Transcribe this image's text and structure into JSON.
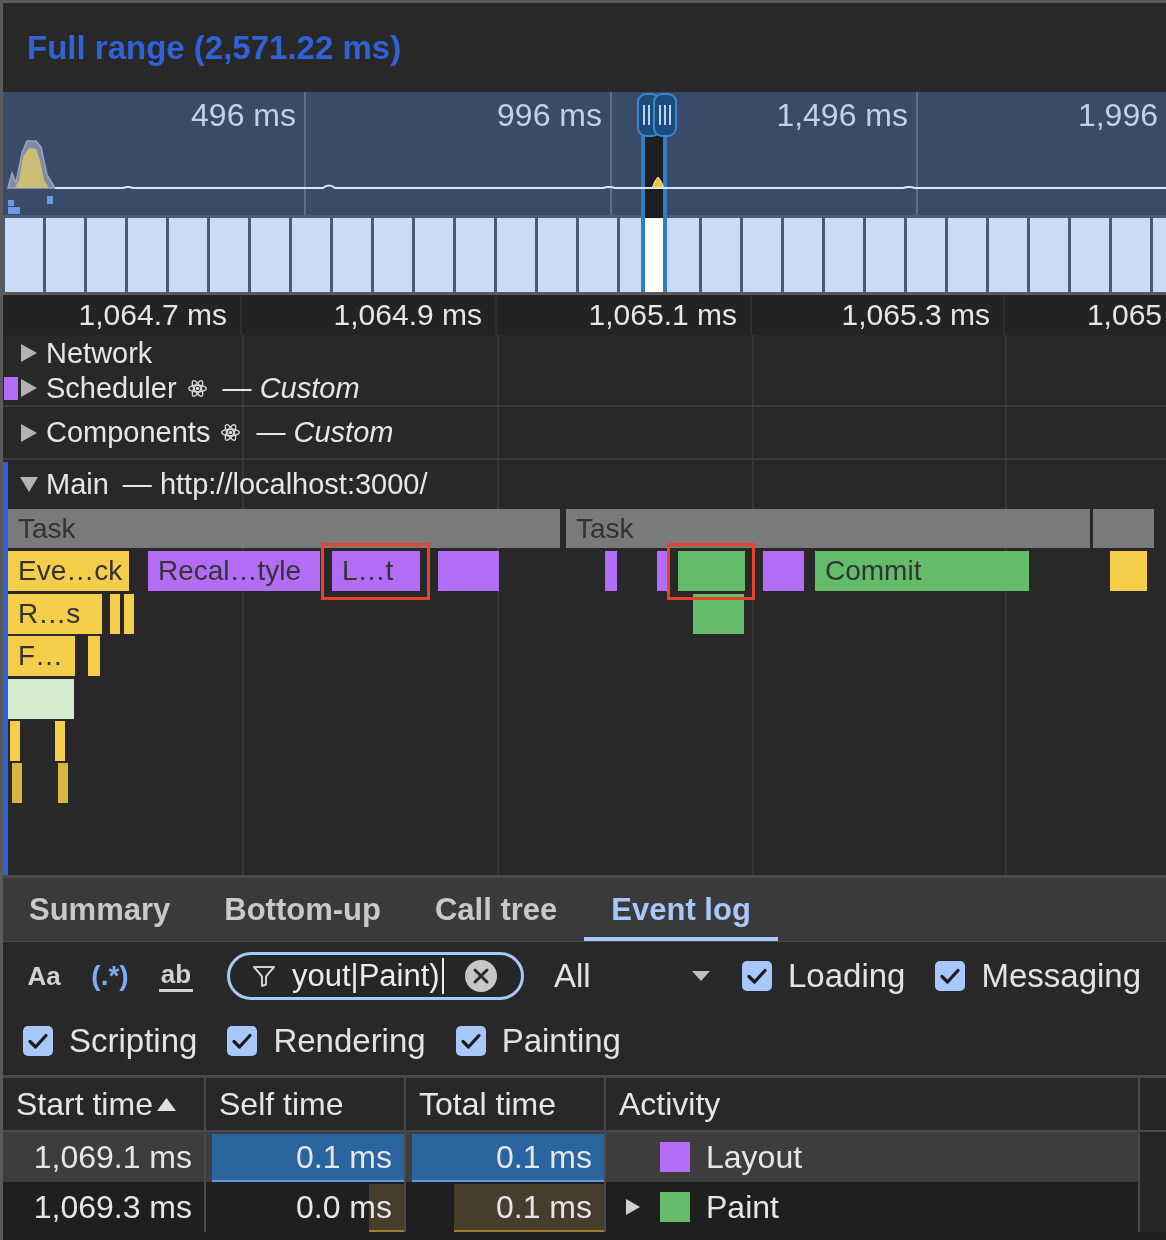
{
  "title": "Full range (2,571.22 ms)",
  "overview": {
    "ticks": [
      "496 ms",
      "996 ms",
      "1,496 ms",
      "1,996"
    ]
  },
  "ruler": {
    "ticks": [
      "1,064.7 ms",
      "1,064.9 ms",
      "1,065.1 ms",
      "1,065.3 ms",
      "1,065"
    ]
  },
  "tracks": [
    {
      "name": "Network",
      "kind": "group",
      "expanded": false,
      "selected": false
    },
    {
      "name": "Scheduler",
      "kind": "custom",
      "subtitle": "— *Custom*",
      "expanded": false,
      "selected": false,
      "events": [
        {
          "color": "#b36cf5"
        }
      ]
    },
    {
      "name": "Components",
      "kind": "custom",
      "subtitle": "— *Custom*",
      "expanded": false,
      "selected": false
    },
    {
      "name": "Main",
      "kind": "thread",
      "subtitle": "— http://localhost:3000/",
      "expanded": true,
      "selected": true,
      "flame_rows": [
        [
          {
            "label": "Task",
            "color": "#7a7a7a",
            "highlighted": false
          },
          {
            "label": "Task",
            "color": "#7a7a7a",
            "highlighted": false
          },
          {
            "color": "#7a7a7a",
            "highlighted": false
          }
        ],
        [
          {
            "label": "Eve…ck",
            "color": "#f4cd4b",
            "highlighted": false
          },
          {
            "label": "Recal…tyle",
            "color": "#b36cf5",
            "highlighted": false
          },
          {
            "label": "L…t",
            "color": "#b36cf5",
            "highlighted": true
          },
          {
            "color": "#b36cf5",
            "highlighted": false
          },
          {
            "color": "#b36cf5",
            "highlighted": false
          },
          {
            "color": "#b36cf5",
            "highlighted": false
          },
          {
            "color": "#64bc6b",
            "highlighted": true
          },
          {
            "color": "#b36cf5",
            "highlighted": false
          },
          {
            "label": "Commit",
            "color": "#64bc6b",
            "highlighted": false
          },
          {
            "color": "#f4cd4b",
            "highlighted": false
          }
        ],
        [
          {
            "label": "R…s",
            "color": "#f4cd4b",
            "highlighted": false
          },
          {
            "color": "#f4cd4b",
            "highlighted": false
          },
          {
            "color": "#f4cd4b",
            "highlighted": false
          },
          {
            "color": "#64bc6b",
            "highlighted": false
          }
        ],
        [
          {
            "label": "F…",
            "color": "#f4cd4b",
            "highlighted": false
          },
          {
            "color": "#f4cd4b",
            "highlighted": false
          }
        ],
        [
          {
            "color": "#d5ebd0",
            "highlighted": false
          }
        ],
        [
          {
            "color": "#f4cd4b",
            "highlighted": false
          },
          {
            "color": "#f4cd4b",
            "highlighted": false
          }
        ],
        [
          {
            "color": "#d9b640",
            "highlighted": false
          },
          {
            "color": "#d9b640",
            "highlighted": false
          }
        ]
      ]
    }
  ],
  "tabs": [
    {
      "label": "Summary",
      "selected": false
    },
    {
      "label": "Bottom-up",
      "selected": false
    },
    {
      "label": "Call tree",
      "selected": false
    },
    {
      "label": "Event log",
      "selected": true
    }
  ],
  "filter": {
    "toggles": [
      {
        "kind": "case",
        "label": "Aa",
        "on": false
      },
      {
        "kind": "regex",
        "label": "(.*)",
        "on": true
      },
      {
        "kind": "word",
        "label": "ab",
        "on": false
      }
    ],
    "value": "yout|Paint)",
    "focused": true,
    "dropdown": "All"
  },
  "checkboxes": [
    {
      "label": "Loading",
      "checked": true
    },
    {
      "label": "Messaging",
      "checked": true
    },
    {
      "label": "Scripting",
      "checked": true
    },
    {
      "label": "Rendering",
      "checked": true
    },
    {
      "label": "Painting",
      "checked": true
    }
  ],
  "table": {
    "columns": [
      {
        "label": "Start time",
        "sorted": true
      },
      {
        "label": "Self time",
        "sorted": false
      },
      {
        "label": "Total time",
        "sorted": false
      },
      {
        "label": "Activity",
        "sorted": false
      }
    ],
    "rows": [
      {
        "start_time": "1,069.1 ms",
        "self_time": {
          "text": "0.1 ms",
          "level": 1
        },
        "total_time": {
          "text": "0.1 ms",
          "level": 1
        },
        "activity": "Layout",
        "color": "#b36cf5",
        "expandable": false,
        "selected": true
      },
      {
        "start_time": "1,069.3 ms",
        "self_time": {
          "text": "0.0 ms",
          "level": 0.18
        },
        "total_time": {
          "text": "0.1 ms",
          "level": 0.78
        },
        "activity": "Paint",
        "color": "#64bc6b",
        "expandable": true,
        "selected": false
      }
    ]
  }
}
